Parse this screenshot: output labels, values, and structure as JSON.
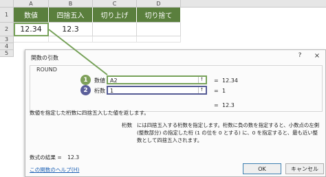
{
  "sheet": {
    "columns": [
      "A",
      "B",
      "C",
      "D"
    ],
    "rows": [
      "1",
      "2",
      "3",
      "4",
      "5"
    ],
    "headers": [
      "数値",
      "四捨五入",
      "切り上げ",
      "切り捨て"
    ],
    "row2": [
      "12.34",
      "12.3",
      "",
      ""
    ]
  },
  "dialog": {
    "title": "関数の引数",
    "help_symbol": "?",
    "close_symbol": "×",
    "function_name": "ROUND",
    "args": [
      {
        "badge": "1",
        "label": "数値",
        "value": "A2",
        "equals": "=",
        "result": "12.34"
      },
      {
        "badge": "2",
        "label": "桁数",
        "value": "1",
        "equals": "=",
        "result": "1"
      }
    ],
    "formula_equals": "=",
    "formula_result": "12.3",
    "description": "数値を指定した桁数に四捨五入した値を返します。",
    "param_name": "桁数",
    "param_description": "には四捨五入する桁数を指定します。桁数に負の数を指定すると、小数点の左側 (整数部分) の指定した桁 (1 の位を 0 とする) に、0 を指定すると、最も近い整数として四捨五入されます。",
    "result_label": "数式の結果 =",
    "result_value": "12.3",
    "help_link": "この関数のヘルプ(H)",
    "ok_label": "OK",
    "cancel_label": "キャンセル",
    "ref_button_symbol": "⭡"
  },
  "colors": {
    "header_green": "#5a7f3d",
    "badge1_green": "#7ea05a",
    "badge2_purple": "#5b5f9a"
  }
}
